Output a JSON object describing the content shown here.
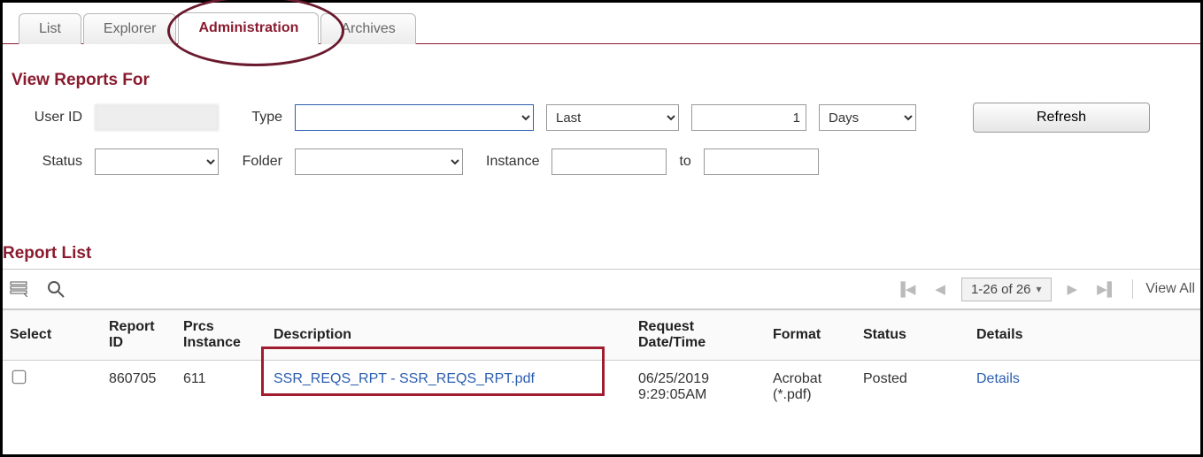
{
  "tabs": [
    {
      "label": "List"
    },
    {
      "label": "Explorer"
    },
    {
      "label": "Administration"
    },
    {
      "label": "Archives"
    }
  ],
  "sectionTitle": "View Reports For",
  "filters": {
    "userId_label": "User ID",
    "type_label": "Type",
    "last_option": "Last",
    "num_value": "1",
    "unit_option": "Days",
    "refresh_label": "Refresh",
    "status_label": "Status",
    "folder_label": "Folder",
    "instance_label": "Instance",
    "to_label": "to"
  },
  "listTitle": "Report List",
  "pager": {
    "range": "1-26 of 26",
    "view_all": "View All"
  },
  "columns": {
    "select": "Select",
    "report_id": "Report ID",
    "prcs": "Prcs Instance",
    "desc": "Description",
    "reqdt": "Request Date/Time",
    "format": "Format",
    "status": "Status",
    "details": "Details"
  },
  "rows": [
    {
      "report_id": "860705",
      "prcs": "611",
      "desc": "SSR_REQS_RPT - SSR_REQS_RPT.pdf",
      "reqdt": "06/25/2019 9:29:05AM",
      "format": "Acrobat (*.pdf)",
      "status": "Posted",
      "details": "Details"
    }
  ]
}
